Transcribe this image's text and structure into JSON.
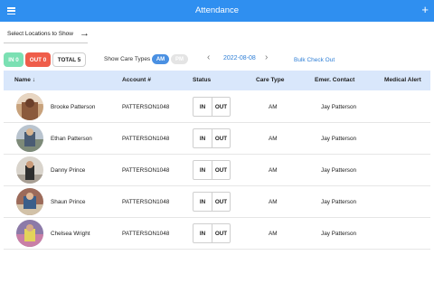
{
  "header": {
    "title": "Attendance",
    "menu_icon": "hamburger-menu-icon",
    "add_icon": "plus-icon"
  },
  "toolbar": {
    "locations_label": "Select Locations to Show",
    "locations_icon": "arrow-right-icon",
    "in_label": "IN 0",
    "out_label": "OUT 0",
    "total_label": "TOTAL 5",
    "care_types_label": "Show Care Types",
    "care_types": [
      {
        "label": "AM",
        "active": true
      },
      {
        "label": "PM",
        "active": false
      }
    ],
    "date": "2022-08-08",
    "prev_icon": "chevron-left-icon",
    "next_icon": "chevron-right-icon",
    "bulk_checkout_label": "Bulk Check Out"
  },
  "colors": {
    "primary": "#2f8ff0",
    "in_pill": "#7be0b3",
    "out_pill": "#ef5d4a",
    "header_row": "#d9e7fb",
    "link": "#2f7fd6"
  },
  "table": {
    "columns": [
      "Name",
      "Account #",
      "Status",
      "Care Type",
      "Emer. Contact",
      "Medical Alert"
    ],
    "sort_icon": "arrow-down-icon",
    "in_label": "IN",
    "out_label": "OUT",
    "rows": [
      {
        "name": "Brooke Patterson",
        "account": "PATTERSON1048",
        "care_type": "AM",
        "contact": "Jay Patterson",
        "alert": ""
      },
      {
        "name": "Ethan Patterson",
        "account": "PATTERSON1048",
        "care_type": "AM",
        "contact": "Jay Patterson",
        "alert": ""
      },
      {
        "name": "Danny Prince",
        "account": "PATTERSON1048",
        "care_type": "AM",
        "contact": "Jay Patterson",
        "alert": ""
      },
      {
        "name": "Shaun Prince",
        "account": "PATTERSON1048",
        "care_type": "AM",
        "contact": "Jay Patterson",
        "alert": ""
      },
      {
        "name": "Chelsea Wright",
        "account": "PATTERSON1048",
        "care_type": "AM",
        "contact": "Jay Patterson",
        "alert": ""
      }
    ]
  }
}
